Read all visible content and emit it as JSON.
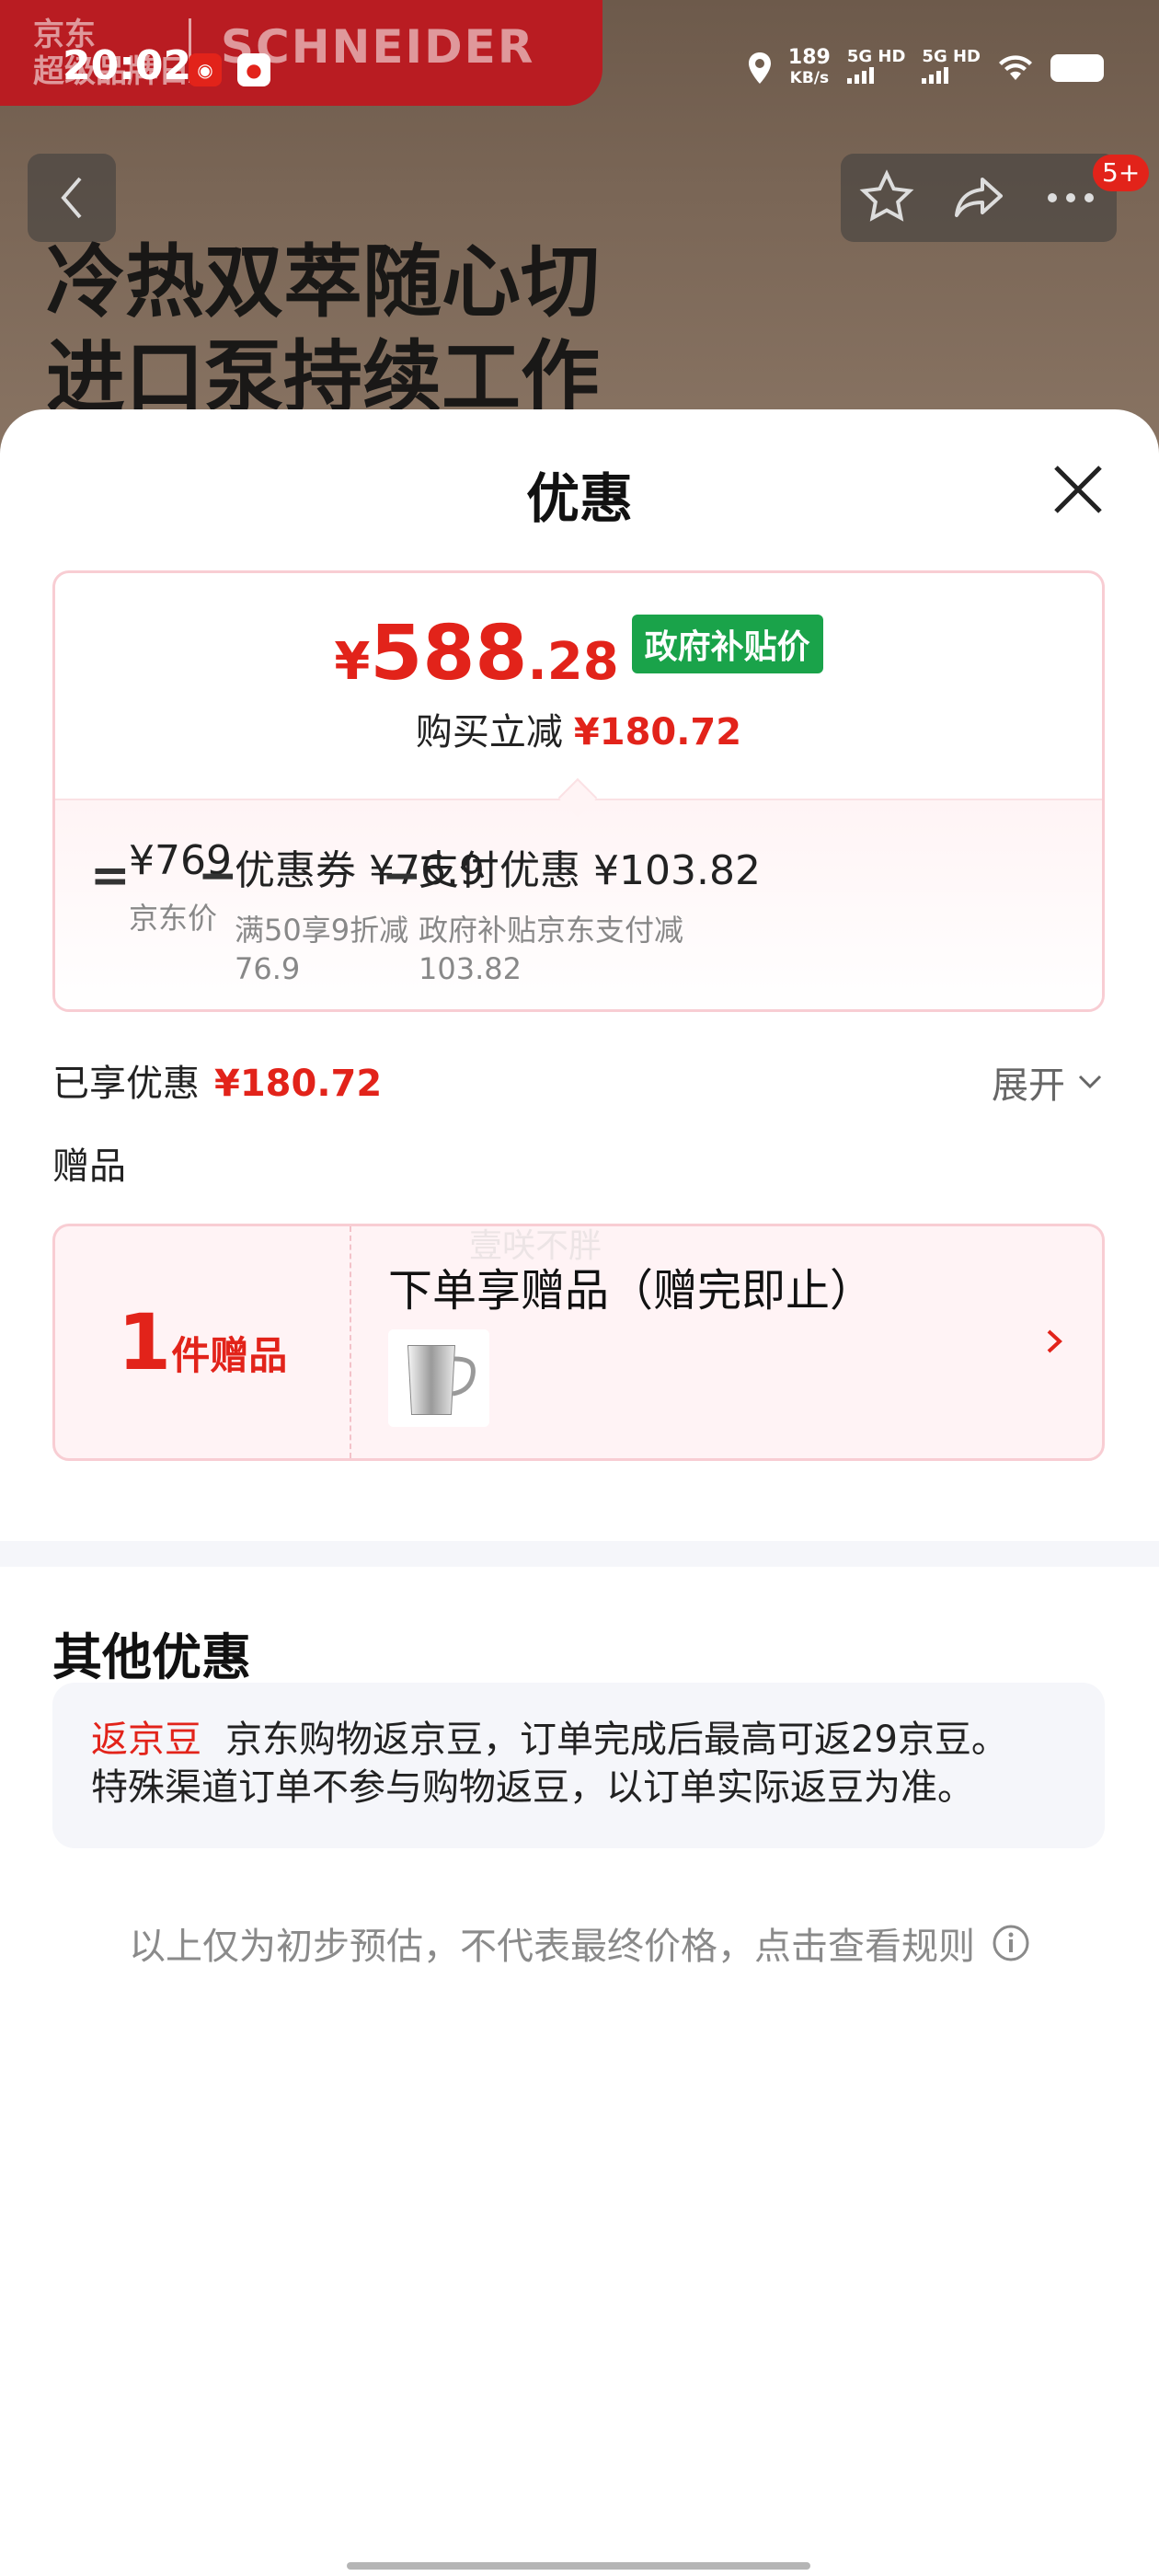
{
  "status_bar": {
    "time": "20:02",
    "speed_value": "189",
    "speed_unit": "KB/s",
    "network_1": "5G HD",
    "network_2": "5G HD"
  },
  "background": {
    "brand_left": "京东\n超级品牌日",
    "brand_name": "SCHNEIDER",
    "headline_1": "冷热双萃随心切",
    "headline_2": "进口泵持续工作",
    "badge": "5+"
  },
  "sheet": {
    "title": "优惠",
    "summary": {
      "price_yen": "¥",
      "price_int": "588",
      "price_dec": ".28",
      "gov_tag": "政府补贴价",
      "reduce_label": "购买立减",
      "reduce_amount": "¥180.72",
      "eq": "=",
      "items": [
        {
          "main": "¥769",
          "sub": "京东价"
        },
        {
          "main": "优惠券 ¥76.9",
          "sub": "满50享9折减\n76.9"
        },
        {
          "main": "支付优惠 ¥103.82",
          "sub": "政府补贴京东支付减\n103.82"
        }
      ],
      "minus": "−"
    },
    "enjoyed_label": "已享优惠",
    "enjoyed_amount": "¥180.72",
    "expand_label": "展开",
    "gift_section_label": "赠品",
    "gift": {
      "count": "1",
      "count_suffix": "件赠品",
      "title": "下单享赠品（赠完即止）"
    },
    "watermark": "壹咲不胖",
    "other_title": "其他优惠",
    "other_tag": "返京豆",
    "other_text_1": "京东购物返京豆，订单完成后最高可返29京豆。",
    "other_text_2": "特殊渠道订单不参与购物返豆，以订单实际返豆为准。",
    "footnote": "以上仅为初步预估，不代表最终价格，点击查看规则"
  }
}
